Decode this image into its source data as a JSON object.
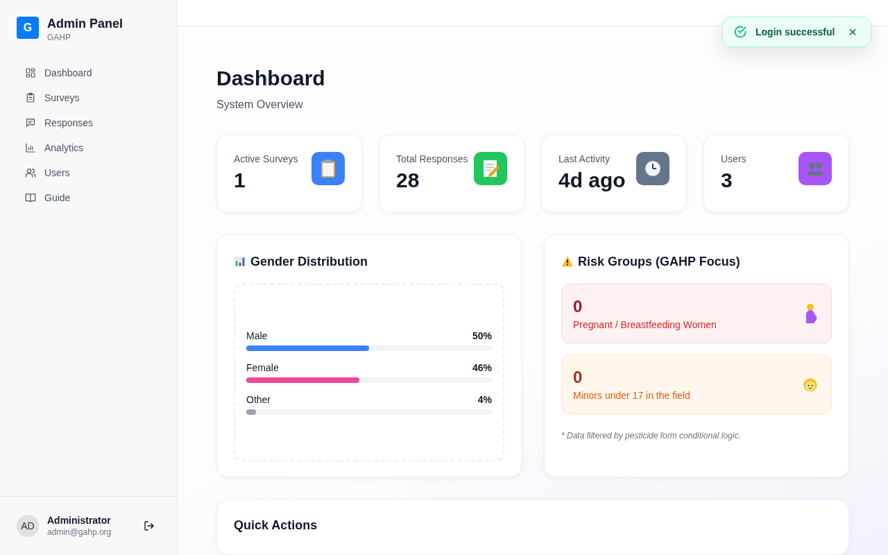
{
  "sidebar": {
    "logo_letter": "G",
    "title": "Admin Panel",
    "subtitle": "GAHP",
    "items": [
      {
        "label": "Dashboard",
        "kind": "grid"
      },
      {
        "label": "Surveys",
        "kind": "clipboard"
      },
      {
        "label": "Responses",
        "kind": "message"
      },
      {
        "label": "Analytics",
        "kind": "chart"
      },
      {
        "label": "Users",
        "kind": "users"
      },
      {
        "label": "Guide",
        "kind": "book"
      }
    ],
    "user": {
      "initials": "AD",
      "name": "Administrator",
      "email": "admin@gahp.org"
    }
  },
  "toast": {
    "message": "Login successful",
    "close": "×"
  },
  "page": {
    "title": "Dashboard",
    "subtitle": "System Overview"
  },
  "stats": [
    {
      "label": "Active Surveys",
      "value": "1",
      "kind": "clipboard",
      "color": "#3b82f6"
    },
    {
      "label": "Total Responses",
      "value": "28",
      "kind": "memo",
      "color": "#22c55e"
    },
    {
      "label": "Last Activity",
      "value": "4d ago",
      "kind": "clock",
      "color": "#64748b"
    },
    {
      "label": "Users",
      "value": "3",
      "kind": "users",
      "color": "#a855f7"
    }
  ],
  "gender": {
    "title": "Gender Distribution",
    "bars": [
      {
        "label": "Male",
        "reading": "50%",
        "level": 0.5,
        "color": "#3b82f6"
      },
      {
        "label": "Female",
        "reading": "46%",
        "level": 0.46,
        "color": "#ec4899"
      },
      {
        "label": "Other",
        "reading": "4%",
        "level": 0.04,
        "color": "#9ca3af"
      }
    ]
  },
  "risk": {
    "title": "Risk Groups (GAHP Focus)",
    "groups": [
      {
        "kind": "pregnant",
        "value": "0",
        "label": "Pregnant / Breastfeeding Women"
      },
      {
        "kind": "minor",
        "value": "0",
        "label": "Minors under 17 in the field"
      }
    ],
    "note": "* Data filtered by pesticide form conditional logic."
  },
  "quick_actions": {
    "title": "Quick Actions"
  }
}
